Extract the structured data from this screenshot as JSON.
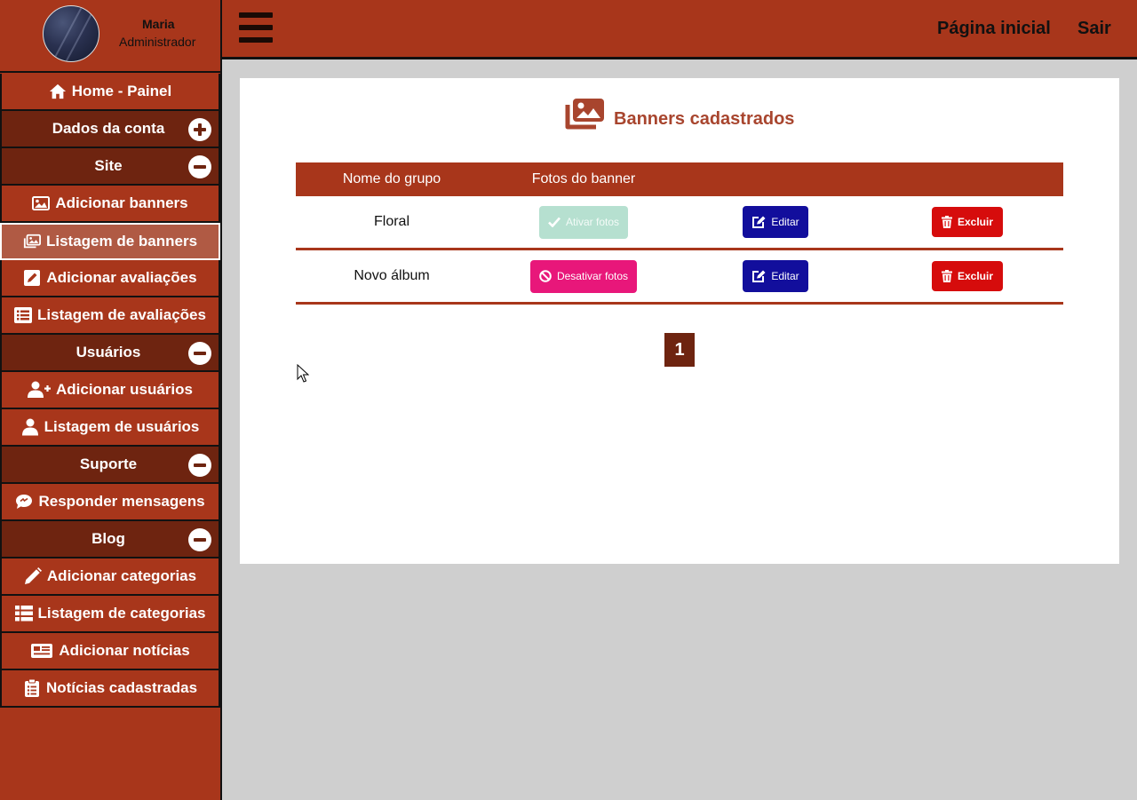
{
  "profile": {
    "name": "Maria",
    "role": "Administrador"
  },
  "sidebar": {
    "items": [
      {
        "label": "Home - Painel",
        "icon": "home-icon"
      },
      {
        "label": "Dados da conta",
        "icon": "plus-circle-icon"
      },
      {
        "label": "Site",
        "icon": "minus-circle-icon"
      },
      {
        "label": "Adicionar banners",
        "icon": "image-icon"
      },
      {
        "label": "Listagem de banners",
        "icon": "images-icon"
      },
      {
        "label": "Adicionar avaliações",
        "icon": "edit-icon"
      },
      {
        "label": "Listagem de avaliações",
        "icon": "list-icon"
      },
      {
        "label": "Usuários",
        "icon": "minus-circle-icon"
      },
      {
        "label": "Adicionar usuários",
        "icon": "user-plus-icon"
      },
      {
        "label": "Listagem de usuários",
        "icon": "user-icon"
      },
      {
        "label": "Suporte",
        "icon": "minus-circle-icon"
      },
      {
        "label": "Responder mensagens",
        "icon": "comment-icon"
      },
      {
        "label": "Blog",
        "icon": "minus-circle-icon"
      },
      {
        "label": "Adicionar categorias",
        "icon": "pencil-icon"
      },
      {
        "label": "Listagem de categorias",
        "icon": "table-list-icon"
      },
      {
        "label": "Adicionar notícias",
        "icon": "newspaper-icon"
      },
      {
        "label": "Notícias cadastradas",
        "icon": "clipboard-list-icon"
      }
    ]
  },
  "topbar": {
    "home_link": "Página inicial",
    "logout_link": "Sair"
  },
  "main": {
    "title": "Banners cadastrados",
    "table": {
      "headers": [
        "Nome do grupo",
        "Fotos do banner"
      ],
      "rows": [
        {
          "name": "Floral",
          "photos_action": "Ativar fotos",
          "edit": "Editar",
          "delete": "Excluir"
        },
        {
          "name": "Novo álbum",
          "photos_action": "Desativar fotos",
          "edit": "Editar",
          "delete": "Excluir"
        }
      ]
    },
    "pagination": {
      "current": "1"
    }
  },
  "colors": {
    "brand": "#a8361b",
    "brand_dark": "#6e2410",
    "edit": "#120e9c",
    "delete": "#d60c0c",
    "deactivate": "#e8177a",
    "activate": "#b6e0d0"
  }
}
